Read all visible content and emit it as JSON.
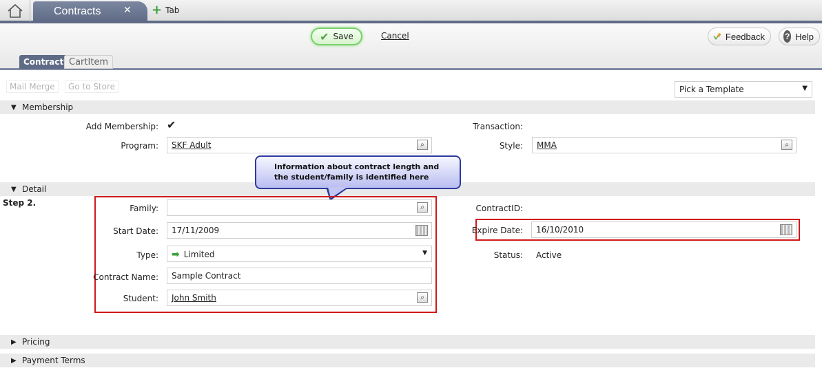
{
  "tabs": {
    "home_icon": "home-icon",
    "active_tab": "Contracts",
    "close_glyph": "✕",
    "add_tab_label": "Tab"
  },
  "toolbar": {
    "save_label": "Save",
    "cancel_label": "Cancel",
    "feedback_label": "Feedback",
    "help_label": "Help",
    "sub_tabs": [
      "Contract*",
      "CartItem"
    ]
  },
  "actions": {
    "mail_merge": "Mail Merge",
    "go_to_store": "Go to Store",
    "template_select": "Pick a Template"
  },
  "sections": {
    "membership": "Membership",
    "detail": "Detail",
    "pricing": "Pricing",
    "payment_terms": "Payment Terms"
  },
  "membership": {
    "add_membership_label": "Add Membership:",
    "add_membership_checked": true,
    "program_label": "Program:",
    "program_value": "SKF Adult",
    "transaction_label": "Transaction:",
    "style_label": "Style:",
    "style_value": "MMA"
  },
  "callout": {
    "line1": "Information about contract length and",
    "line2": "the student/family is identified here"
  },
  "step_label": "Step 2.",
  "detail": {
    "family_label": "Family:",
    "family_value": "",
    "start_date_label": "Start Date:",
    "start_date_value": "17/11/2009",
    "type_label": "Type:",
    "type_value": "Limited",
    "contract_name_label": "Contract Name:",
    "contract_name_value": "Sample Contract",
    "student_label": "Student:",
    "student_value": "John Smith",
    "contract_id_label": "ContractID:",
    "expire_date_label": "Expire Date:",
    "expire_date_value": "16/10/2010",
    "status_label": "Status:",
    "status_value": "Active"
  },
  "colors": {
    "tab_accent": "#5f6b86",
    "highlight_border": "#d01919",
    "save_glow": "#7ad16b",
    "callout_border": "#2b3a9d"
  }
}
